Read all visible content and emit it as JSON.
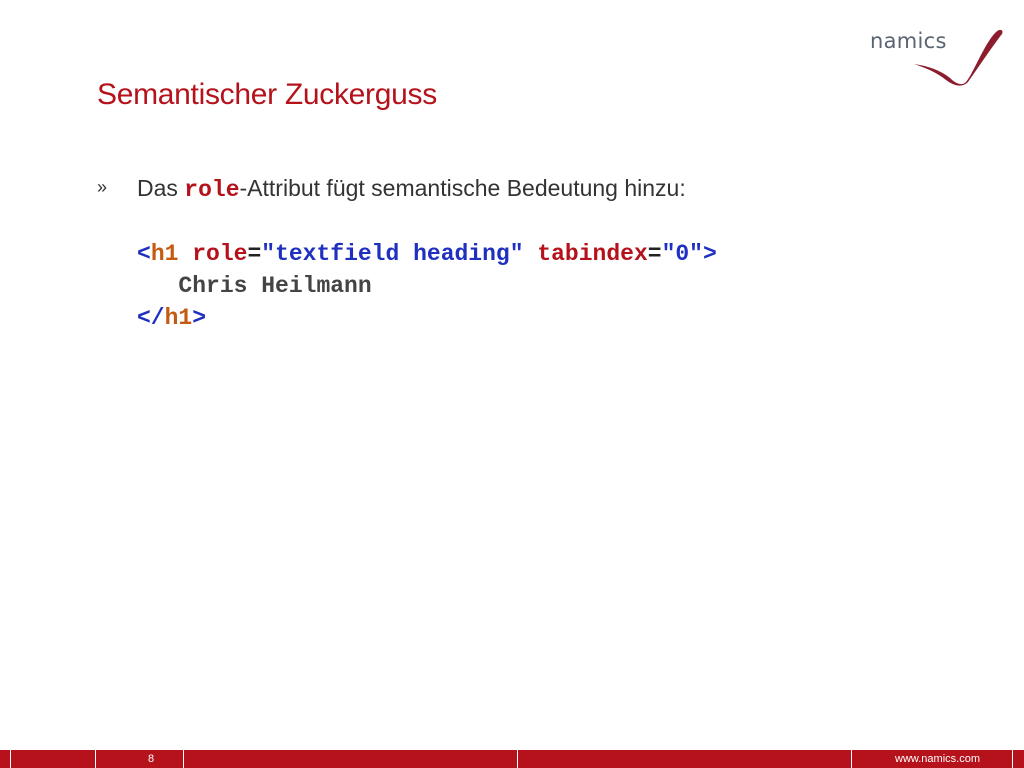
{
  "logo": {
    "text": "namics",
    "icon": "namics-swoosh-logo",
    "accent": "#8c1d2f"
  },
  "title": "Semantischer Zuckerguss",
  "bullet": {
    "mark": "»",
    "before": "Das ",
    "code": "role",
    "after": "-Attribut fügt semantische Bedeutung hinzu:"
  },
  "code": {
    "open_lt": "<",
    "open_tag": "h1",
    "attr1": "role",
    "eq1": "=",
    "val1": "\"textfield heading\"",
    "attr2": "tabindex",
    "eq2": "=",
    "val2": "\"0\"",
    "open_gt": ">",
    "content": "Chris Heilmann",
    "close_lt": "</",
    "close_tag": "h1",
    "close_gt": ">"
  },
  "footer": {
    "page": "8",
    "url": "www.namics.com"
  },
  "colors": {
    "brand_red": "#b5121b",
    "code_blue": "#1f2fbf",
    "code_orange": "#c55a11"
  }
}
